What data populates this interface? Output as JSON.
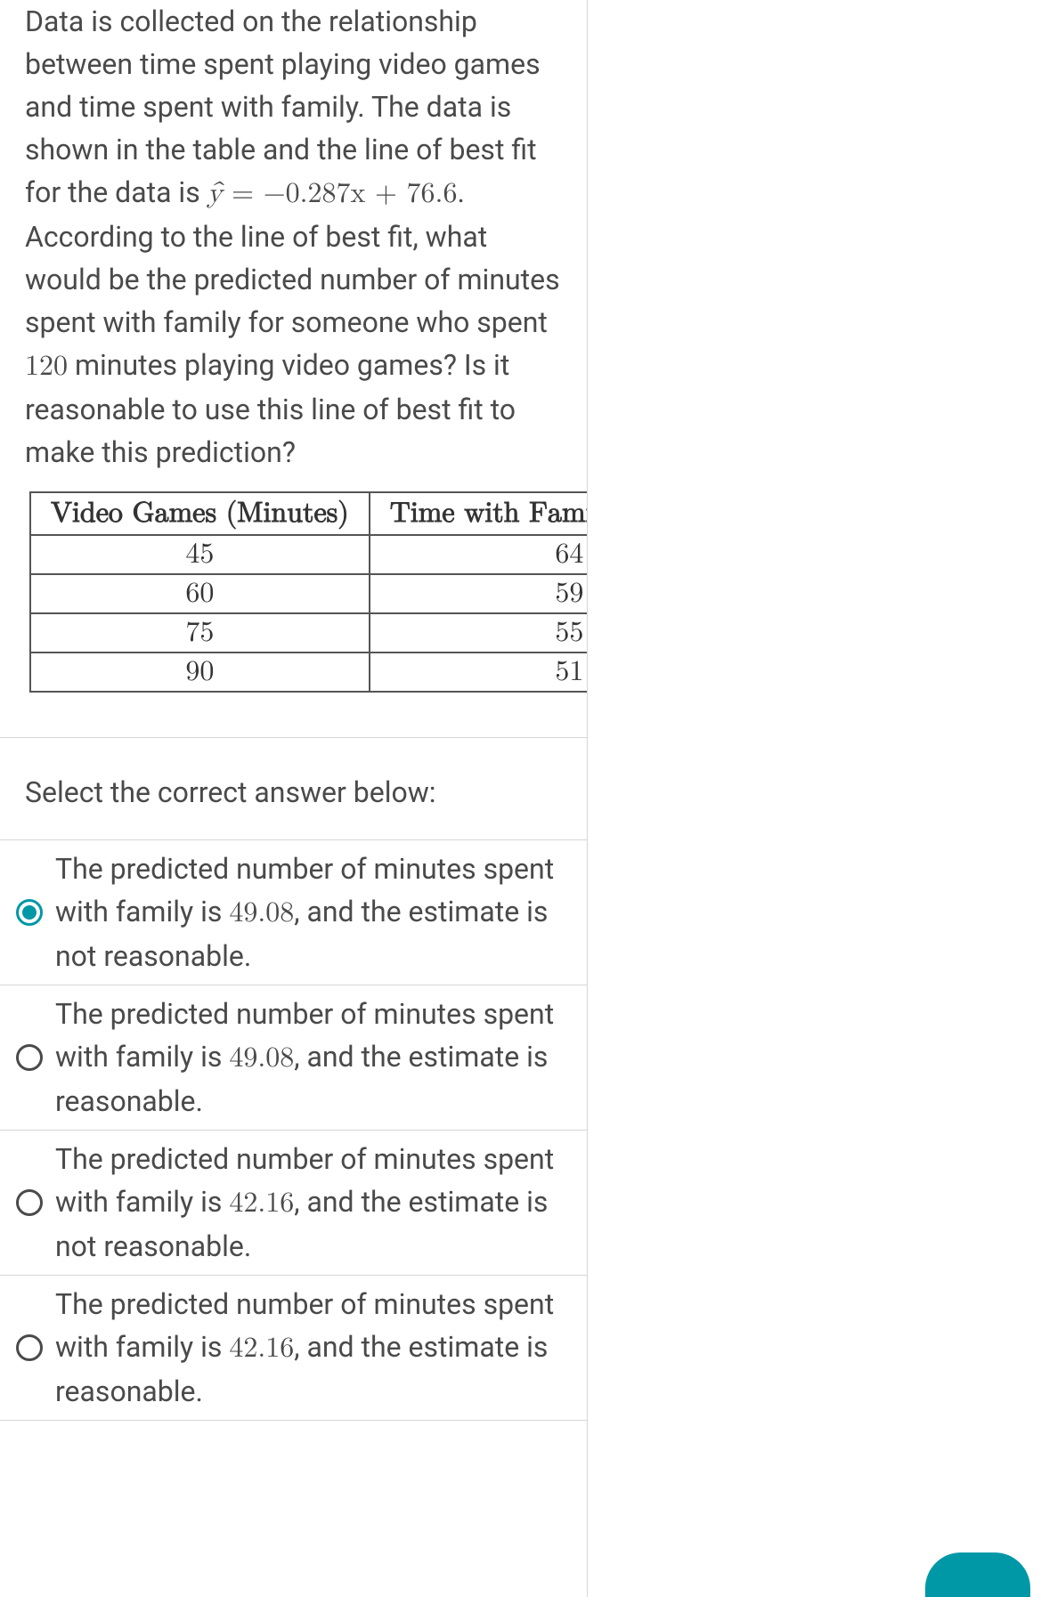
{
  "question": {
    "p1": "Data is collected on the relationship between time spent playing video games and time spent with family. The data is shown in the table and the line of best fit for the data is ",
    "eq_lhs": "ŷ",
    "eq_eq": " = ",
    "eq_rhs": "−0.287x + 76.6",
    "p2": ". According to the line of best fit, what would be the predicted number of minutes spent with family for someone who spent ",
    "minutes_value": "120",
    "p3": " minutes playing video games? Is it reasonable to use this line of best fit to make this prediction?"
  },
  "table": {
    "headers": [
      "Video Games (Minutes)",
      "Time with Family (Minutes)"
    ],
    "rows": [
      [
        "45",
        "64"
      ],
      [
        "60",
        "59"
      ],
      [
        "75",
        "55"
      ],
      [
        "90",
        "51"
      ]
    ]
  },
  "select_prompt": "Select the correct answer below:",
  "answers": [
    {
      "pre": "The predicted number of minutes spent with family is ",
      "num": "49.08",
      "post": ", and the estimate is not reasonable.",
      "selected": true
    },
    {
      "pre": "The predicted number of minutes spent with family is ",
      "num": "49.08",
      "post": ", and the estimate is reasonable.",
      "selected": false
    },
    {
      "pre": "The predicted number of minutes spent with family is ",
      "num": "42.16",
      "post": ", and the estimate is not reasonable.",
      "selected": false
    },
    {
      "pre": "The predicted number of minutes spent with family is ",
      "num": "42.16",
      "post": ", and the estimate is reasonable.",
      "selected": false
    }
  ]
}
